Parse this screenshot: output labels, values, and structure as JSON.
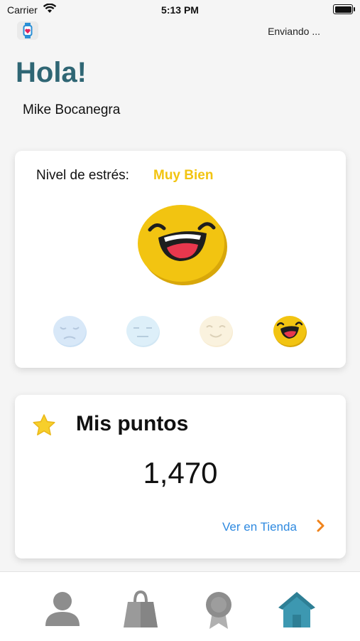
{
  "status_bar": {
    "carrier": "Carrier",
    "time": "5:13 PM"
  },
  "header": {
    "sending_text": "Enviando ...",
    "greeting": "Hola!",
    "user_name": "Mike Bocanegra"
  },
  "stress_card": {
    "label": "Nivel de estrés:",
    "value": "Muy Bien",
    "value_color": "#f2c411",
    "levels": [
      "sad",
      "neutral",
      "smile",
      "laugh"
    ],
    "selected_level": "laugh"
  },
  "points_card": {
    "title": "Mis puntos",
    "points": "1,470",
    "store_link": "Ver en Tienda"
  },
  "tab_bar": {
    "tabs": [
      {
        "icon": "profile-icon"
      },
      {
        "icon": "shopping-bag-icon"
      },
      {
        "icon": "award-icon"
      },
      {
        "icon": "home-icon",
        "active": true
      }
    ]
  },
  "colors": {
    "accent": "#2f6674",
    "link": "#2f8ae0",
    "chevron": "#f0831b",
    "star": "#f7cf2b",
    "home": "#2e7f95"
  }
}
